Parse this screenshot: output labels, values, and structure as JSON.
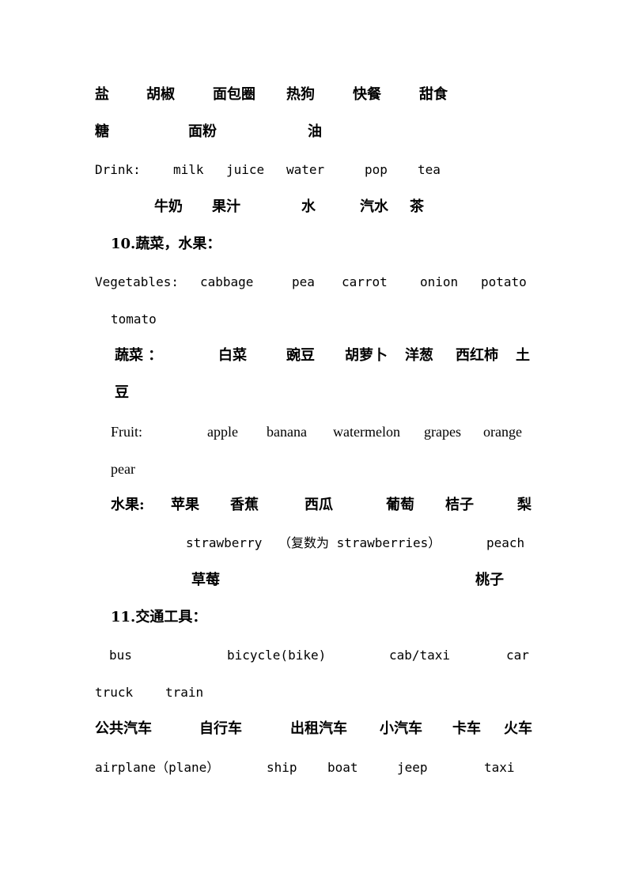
{
  "document": {
    "food_zh_row1": [
      "盐",
      "胡椒",
      "面包圈",
      "热狗",
      "快餐",
      "甜食"
    ],
    "food_zh_row2": [
      "糖",
      "面粉",
      "油"
    ],
    "drink": {
      "label": "Drink:",
      "items_en": [
        "milk",
        "juice",
        "water",
        "pop",
        "tea"
      ],
      "items_zh": [
        "牛奶",
        "果汁",
        "水",
        "汽水",
        "茶"
      ]
    },
    "section10": {
      "heading": "10.蔬菜，水果：",
      "vegetables": {
        "label": "Vegetables:",
        "items_en": [
          "cabbage",
          "pea",
          "carrot",
          "onion",
          "potato",
          "tomato"
        ],
        "label_zh": "蔬菜 ：",
        "items_zh": [
          "白菜",
          "豌豆",
          "胡萝卜",
          "洋葱",
          "西红柿",
          "土",
          "豆"
        ]
      },
      "fruit": {
        "label": "Fruit:",
        "items_en": [
          "apple",
          "banana",
          "watermelon",
          "grapes",
          "orange",
          "pear"
        ],
        "label_zh": "水果:",
        "items_zh": [
          "苹果",
          "香蕉",
          "西瓜",
          "葡萄",
          "桔子",
          "梨"
        ],
        "extra_en": [
          "strawberry",
          "（复数为 strawberries）",
          "peach"
        ],
        "extra_zh": [
          "草莓",
          "桃子"
        ]
      }
    },
    "section11": {
      "heading": "11.交通工具：",
      "items_en_row1": [
        "bus",
        "bicycle(bike)",
        "cab/taxi",
        "car"
      ],
      "items_en_row2": [
        "truck",
        "train"
      ],
      "items_zh": [
        "公共汽车",
        "自行车",
        "出租汽车",
        "小汽车",
        "卡车",
        "火车"
      ],
      "items_en_row3": [
        "airplane（plane）",
        "ship",
        "boat",
        "jeep",
        "taxi"
      ]
    }
  }
}
